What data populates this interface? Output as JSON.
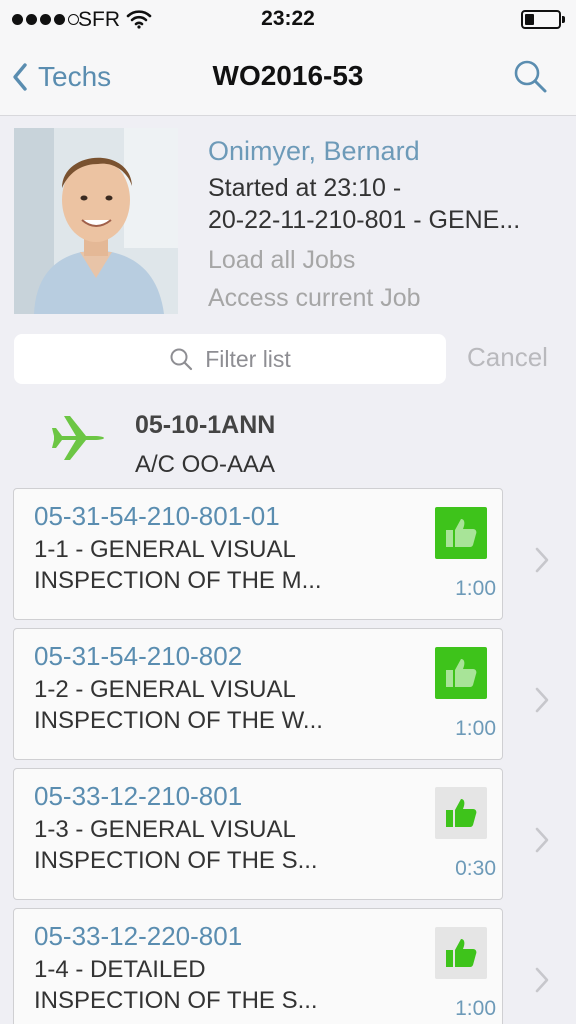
{
  "status_bar": {
    "carrier": "SFR",
    "time": "23:22"
  },
  "nav": {
    "back_label": "Techs",
    "title": "WO2016-53"
  },
  "tech": {
    "name": "Onimyer, Bernard",
    "started": "Started at 23:10 -",
    "current_job": "20-22-11-210-801 - GENE...",
    "load_all": "Load all Jobs",
    "access_current": "Access current Job"
  },
  "filter": {
    "placeholder": "Filter list",
    "cancel": "Cancel"
  },
  "aircraft": {
    "code": "05-10-1ANN",
    "registration": "A/C OO-AAA"
  },
  "jobs": [
    {
      "number": "05-31-54-210-801-01",
      "line1": "1-1 - GENERAL VISUAL",
      "line2": "INSPECTION OF THE M...",
      "duration": "1:00",
      "status": "done"
    },
    {
      "number": "05-31-54-210-802",
      "line1": "1-2 - GENERAL VISUAL",
      "line2": "INSPECTION OF THE W...",
      "duration": "1:00",
      "status": "done"
    },
    {
      "number": "05-33-12-210-801",
      "line1": "1-3 - GENERAL VISUAL",
      "line2": "INSPECTION OF THE S...",
      "duration": "0:30",
      "status": "pending"
    },
    {
      "number": "05-33-12-220-801",
      "line1": "1-4 - DETAILED",
      "line2": "INSPECTION OF THE S...",
      "duration": "1:00",
      "status": "pending"
    }
  ],
  "colors": {
    "accent": "#5a8db0",
    "done": "#3ec31b",
    "plane": "#6cc644"
  },
  "icons": {
    "back": "chevron-left-icon",
    "search": "search-icon",
    "plane": "airplane-icon",
    "status": "thumbs-up-icon",
    "row": "chevron-right-icon"
  }
}
